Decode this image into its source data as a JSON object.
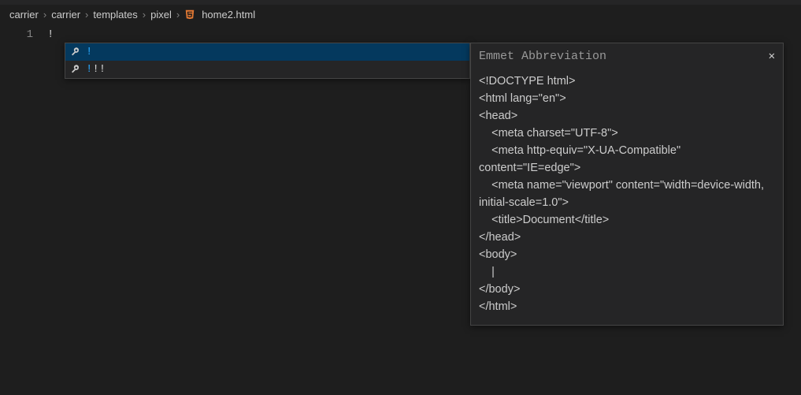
{
  "breadcrumb": {
    "items": [
      "carrier",
      "carrier",
      "templates",
      "pixel"
    ],
    "filename": "home2.html"
  },
  "editor": {
    "line_number": "1",
    "code": "!"
  },
  "suggest": {
    "items": [
      {
        "highlight": "!",
        "rest": ""
      },
      {
        "highlight": "!",
        "rest": "!!"
      }
    ]
  },
  "preview": {
    "title": "Emmet Abbreviation",
    "lines": [
      "<!DOCTYPE html>",
      "<html lang=\"en\">",
      "<head>",
      "    <meta charset=\"UTF-8\">",
      "    <meta http-equiv=\"X-UA-Compatible\" content=\"IE=edge\">",
      "    <meta name=\"viewport\" content=\"width=device-width, initial-scale=1.0\">",
      "    <title>Document</title>",
      "</head>",
      "<body>",
      "    |",
      "</body>",
      "</html>"
    ]
  }
}
